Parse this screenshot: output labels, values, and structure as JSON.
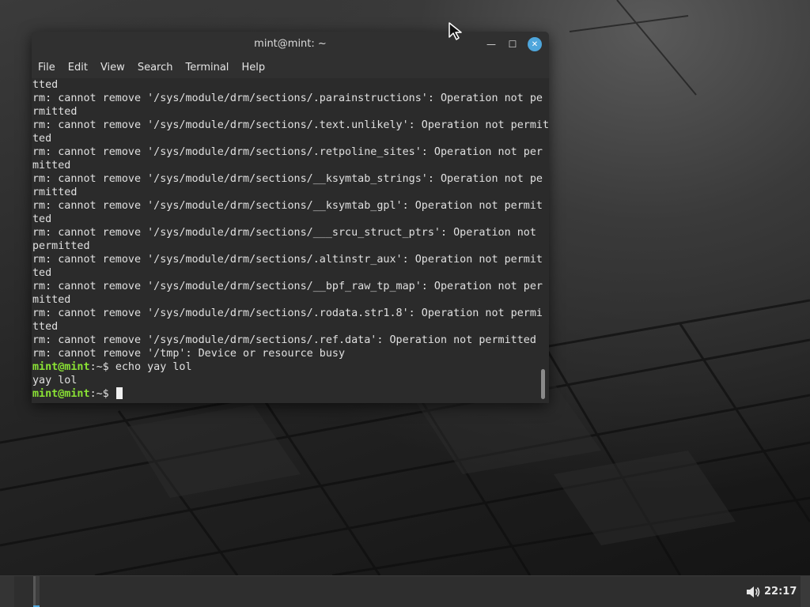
{
  "window": {
    "title": "mint@mint: ~",
    "minimize_glyph": "—",
    "maximize_glyph": "☐",
    "close_glyph": "✕"
  },
  "menubar": {
    "items": [
      "File",
      "Edit",
      "View",
      "Search",
      "Terminal",
      "Help"
    ]
  },
  "terminal": {
    "lines": [
      "tted",
      "rm: cannot remove '/sys/module/drm/sections/.parainstructions': Operation not pe",
      "rmitted",
      "rm: cannot remove '/sys/module/drm/sections/.text.unlikely': Operation not permit",
      "ted",
      "rm: cannot remove '/sys/module/drm/sections/.retpoline_sites': Operation not per",
      "mitted",
      "rm: cannot remove '/sys/module/drm/sections/__ksymtab_strings': Operation not pe",
      "rmitted",
      "rm: cannot remove '/sys/module/drm/sections/__ksymtab_gpl': Operation not permit",
      "ted",
      "rm: cannot remove '/sys/module/drm/sections/___srcu_struct_ptrs': Operation not",
      "permitted",
      "rm: cannot remove '/sys/module/drm/sections/.altinstr_aux': Operation not permit",
      "ted",
      "rm: cannot remove '/sys/module/drm/sections/__bpf_raw_tp_map': Operation not per",
      "mitted",
      "rm: cannot remove '/sys/module/drm/sections/.rodata.str1.8': Operation not permi",
      "tted",
      "rm: cannot remove '/sys/module/drm/sections/.ref.data': Operation not permitted",
      "rm: cannot remove '/tmp': Device or resource busy"
    ],
    "prompt_user": "mint@mint",
    "prompt_path": ":~$ ",
    "command": "echo yay lol",
    "command_output": "yay lol"
  },
  "taskbar": {
    "clock": "22:17",
    "volume_icon": "volume-icon"
  },
  "colors": {
    "prompt_green": "#8ae234",
    "close_button_blue": "#4ea6dc",
    "terminal_background": "#2b2b2b"
  }
}
